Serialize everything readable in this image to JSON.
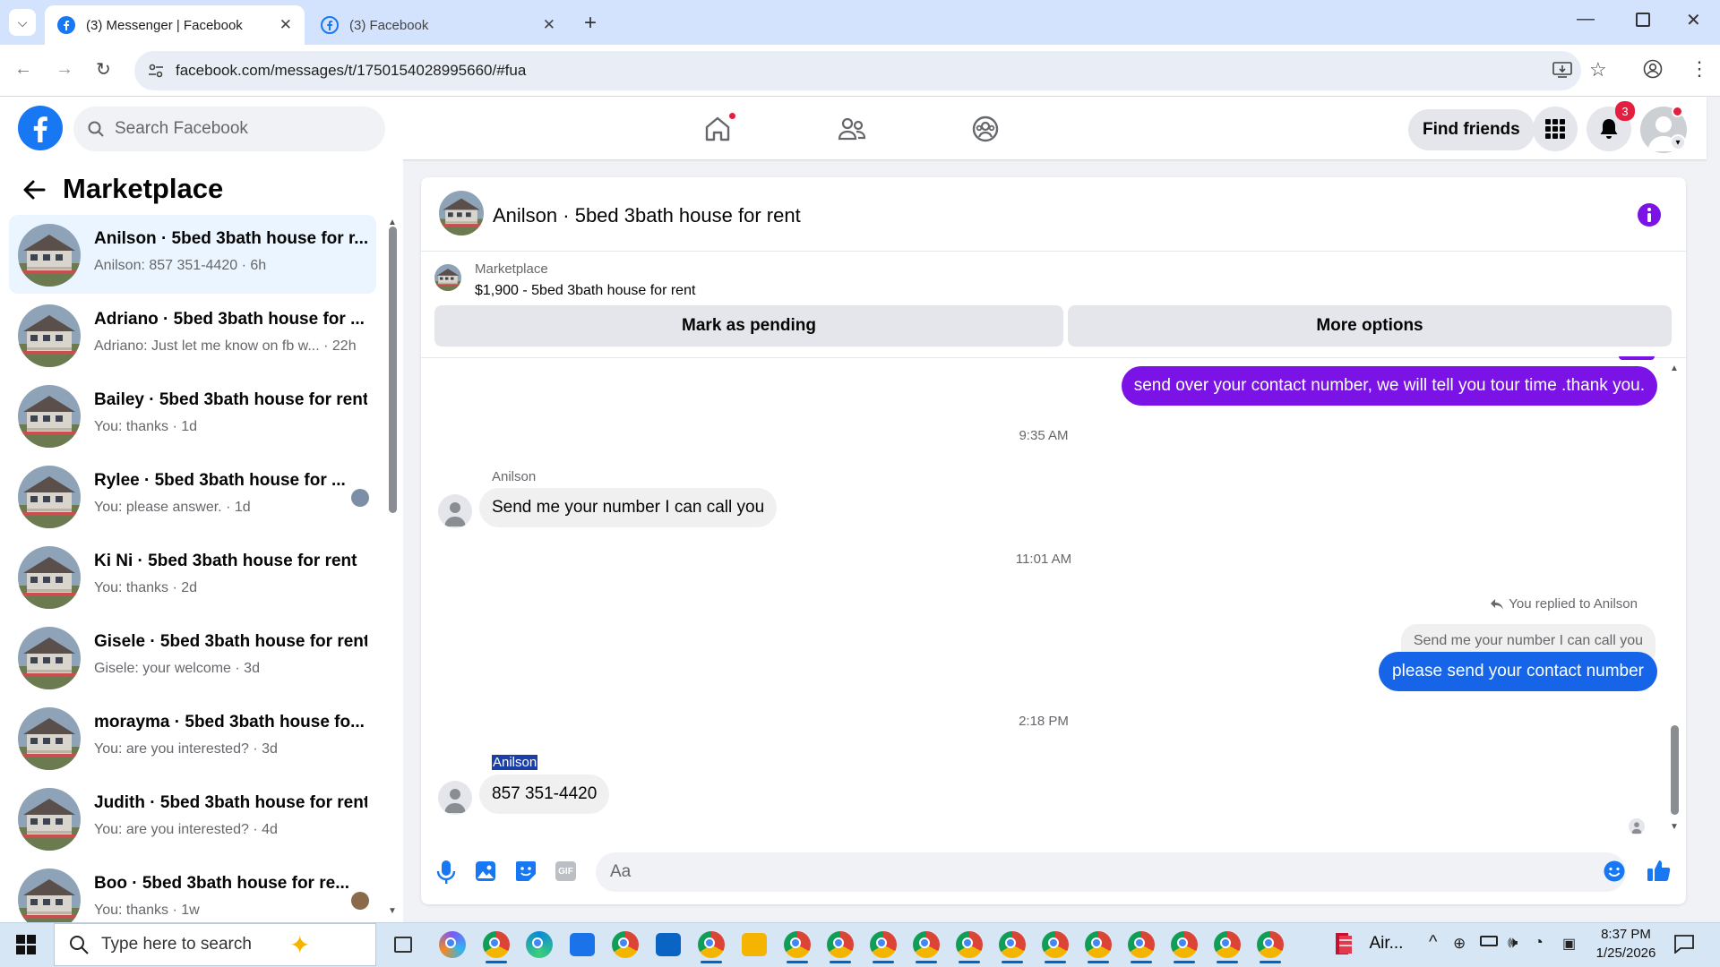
{
  "browser": {
    "tabs": [
      {
        "label": "(3) Messenger | Facebook",
        "active": true
      },
      {
        "label": "(3) Facebook",
        "active": false
      }
    ],
    "url": "facebook.com/messages/t/1750154028995660/#fua",
    "new_tab_glyph": "+"
  },
  "header": {
    "search_placeholder": "Search Facebook",
    "find_friends": "Find friends",
    "notification_count": "3"
  },
  "sidebar": {
    "title": "Marketplace",
    "conversations": [
      {
        "name": "Anilson · 5bed 3bath house for r...",
        "preview": "Anilson: 857 351-4420 · 6h",
        "selected": true
      },
      {
        "name": "Adriano · 5bed 3bath house for ...",
        "preview": "Adriano: Just let me know on fb w... · 22h"
      },
      {
        "name": "Bailey · 5bed 3bath house for rent",
        "preview": "You: thanks · 1d"
      },
      {
        "name": "Rylee · 5bed 3bath house for ...",
        "preview": "You: please answer. · 1d"
      },
      {
        "name": "Ki Ni · 5bed 3bath house for rent",
        "preview": "You: thanks · 2d"
      },
      {
        "name": "Gisele · 5bed 3bath house for rent",
        "preview": "Gisele: your welcome · 3d"
      },
      {
        "name": "morayma · 5bed 3bath house fo...",
        "preview": "You: are you interested? · 3d"
      },
      {
        "name": "Judith · 5bed 3bath house for rent",
        "preview": "You: are you interested? · 4d"
      },
      {
        "name": "Boo · 5bed 3bath house for re...",
        "preview": "You: thanks · 1w"
      }
    ]
  },
  "chat": {
    "title": "Anilson · 5bed 3bath house for rent",
    "listing": {
      "source": "Marketplace",
      "summary": "$1,900 - 5bed 3bath house for rent"
    },
    "buttons": {
      "mark_pending": "Mark as pending",
      "more_options": "More options"
    },
    "messages": {
      "outgoing_1": "send over your contact number, we will tell you tour time .thank you.",
      "time_1": "9:35 AM",
      "sender_1": "Anilson",
      "incoming_1": "Send me your number I can call you",
      "time_2": "11:01 AM",
      "reply_label": "You replied to Anilson",
      "reply_quote": "Send me your number I can call you",
      "outgoing_2": "please send your contact number",
      "time_3": "2:18 PM",
      "sender_2": "Anilson",
      "incoming_2": "857 351-4420"
    },
    "composer_placeholder": "Aa",
    "gif_label": "GIF"
  },
  "taskbar": {
    "search_placeholder": "Type here to search",
    "app_label": "Air...",
    "time": "8:37 PM",
    "date": "1/25/2026"
  },
  "colors": {
    "fb_blue": "#1877f2",
    "outgoing_purple": "#7b12e6",
    "outgoing_blue": "#1665e8",
    "selected_bg": "#ebf5ff",
    "badge_red": "#e41e3f"
  }
}
